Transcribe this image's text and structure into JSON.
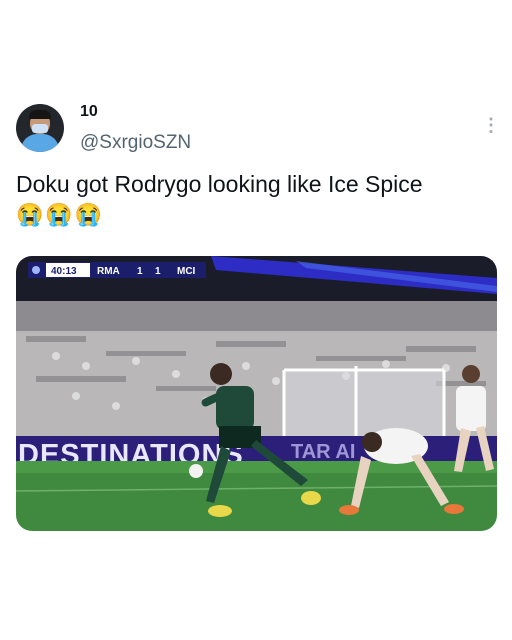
{
  "tweet": {
    "display_name": "10",
    "handle": "@SxrgioSZN",
    "text": "Doku got Rodrygo looking like Ice Spice",
    "emojis": "😭😭😭",
    "more_icon": "more-vertical-icon"
  },
  "scoreboard": {
    "time": "40:13",
    "home": "RMA",
    "home_score": "1",
    "away_score": "1",
    "away": "MCI"
  },
  "ad_board": {
    "text": "DESTINATIONS"
  },
  "colors": {
    "text": "#0f1419",
    "secondary": "#536471",
    "pitch": "#3f8a3e",
    "scoreboard": "#1b1f6b"
  }
}
